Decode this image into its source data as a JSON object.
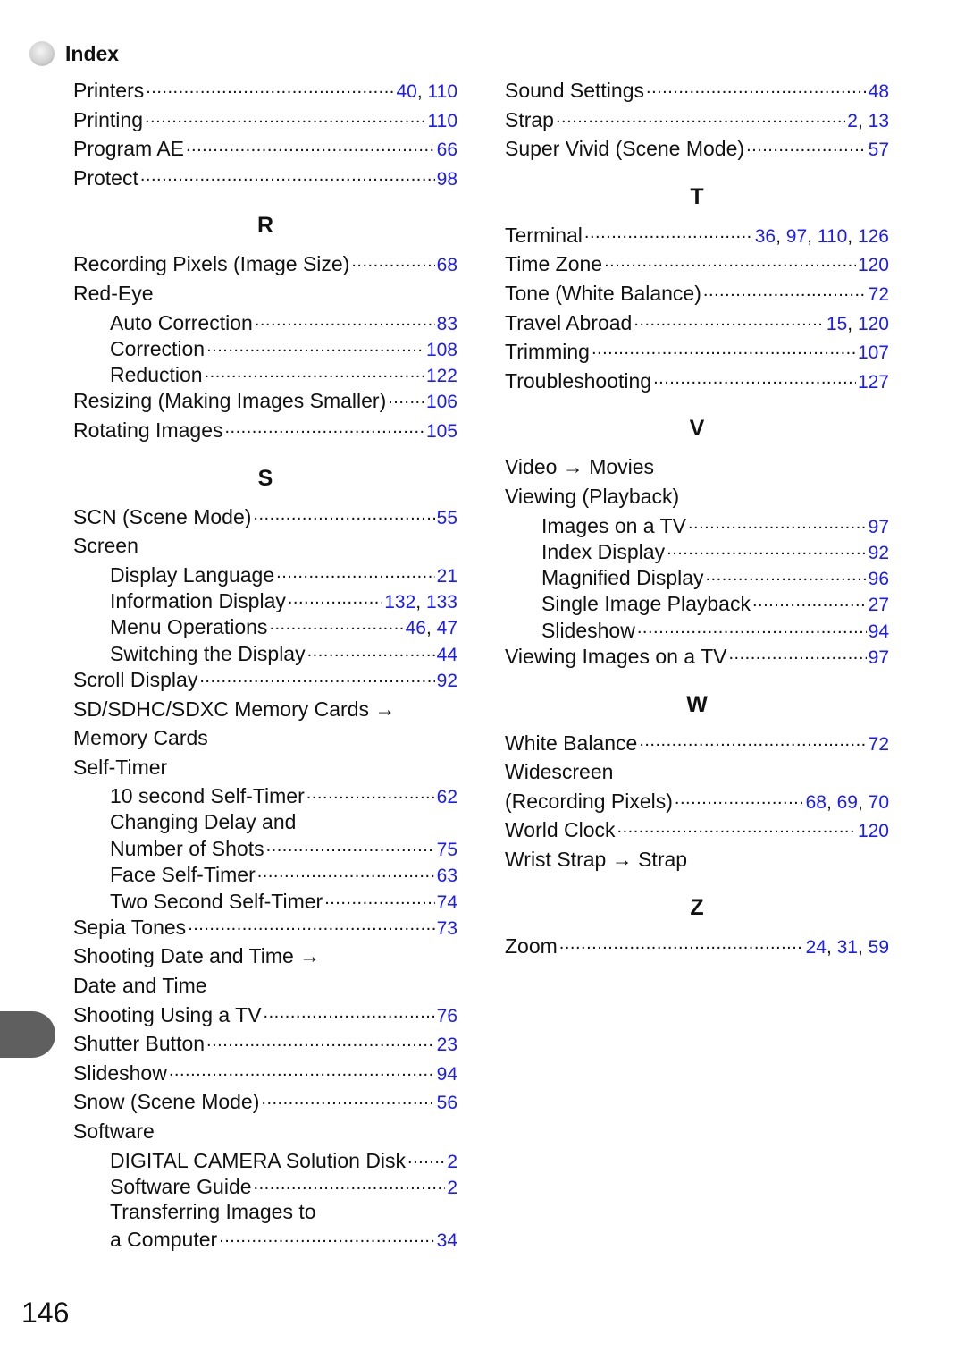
{
  "header": {
    "title": "Index",
    "icon": "gray-sphere-bullet"
  },
  "page_number": "146",
  "colors": {
    "page_ref": "#1a1aff",
    "text": "#111111",
    "side_tab": "#5f5f5f"
  },
  "left_column": [
    {
      "type": "entry",
      "term": "Printers",
      "pages": [
        "40",
        "110"
      ]
    },
    {
      "type": "entry",
      "term": "Printing",
      "pages": [
        "110"
      ]
    },
    {
      "type": "entry",
      "term": "Program AE",
      "pages": [
        "66"
      ]
    },
    {
      "type": "entry",
      "term": "Protect",
      "pages": [
        "98"
      ]
    },
    {
      "type": "letter",
      "term": "R"
    },
    {
      "type": "entry",
      "term": "Recording Pixels (Image Size)",
      "pages": [
        "68"
      ]
    },
    {
      "type": "entry",
      "term": "Red-Eye",
      "pages": []
    },
    {
      "type": "sub",
      "term": "Auto Correction",
      "pages": [
        "83"
      ]
    },
    {
      "type": "sub",
      "term": "Correction",
      "pages": [
        "108"
      ]
    },
    {
      "type": "sub",
      "term": "Reduction",
      "pages": [
        "122"
      ]
    },
    {
      "type": "entry",
      "term": "Resizing (Making Images Smaller)",
      "pages": [
        "106"
      ]
    },
    {
      "type": "entry",
      "term": "Rotating Images",
      "pages": [
        "105"
      ]
    },
    {
      "type": "letter",
      "term": "S"
    },
    {
      "type": "entry",
      "term": "SCN (Scene Mode)",
      "pages": [
        "55"
      ]
    },
    {
      "type": "entry",
      "term": "Screen",
      "pages": []
    },
    {
      "type": "sub",
      "term": "Display Language",
      "pages": [
        "21"
      ]
    },
    {
      "type": "sub",
      "term": "Information Display",
      "pages": [
        "132",
        "133"
      ]
    },
    {
      "type": "sub",
      "term": "Menu Operations",
      "pages": [
        "46",
        "47"
      ]
    },
    {
      "type": "sub",
      "term": "Switching the Display",
      "pages": [
        "44"
      ]
    },
    {
      "type": "entry",
      "term": "Scroll Display",
      "pages": [
        "92"
      ]
    },
    {
      "type": "entry",
      "term": "SD/SDHC/SDXC Memory Cards →",
      "pages": []
    },
    {
      "type": "entry",
      "term": "Memory Cards",
      "pages": []
    },
    {
      "type": "entry",
      "term": "Self-Timer",
      "pages": []
    },
    {
      "type": "sub",
      "term": "10 second Self-Timer",
      "pages": [
        "62"
      ]
    },
    {
      "type": "sub",
      "term": "Changing Delay and",
      "pages": []
    },
    {
      "type": "sub",
      "term": "Number of Shots",
      "pages": [
        "75"
      ]
    },
    {
      "type": "sub",
      "term": "Face Self-Timer",
      "pages": [
        "63"
      ]
    },
    {
      "type": "sub",
      "term": "Two Second Self-Timer",
      "pages": [
        "74"
      ]
    },
    {
      "type": "entry",
      "term": "Sepia Tones",
      "pages": [
        "73"
      ]
    },
    {
      "type": "entry",
      "term": "Shooting Date and Time →",
      "pages": []
    },
    {
      "type": "entry",
      "term": "Date and Time",
      "pages": []
    },
    {
      "type": "entry",
      "term": "Shooting Using a TV",
      "pages": [
        "76"
      ]
    },
    {
      "type": "entry",
      "term": "Shutter Button",
      "pages": [
        "23"
      ]
    },
    {
      "type": "entry",
      "term": "Slideshow",
      "pages": [
        "94"
      ]
    },
    {
      "type": "entry",
      "term": "Snow (Scene Mode)",
      "pages": [
        "56"
      ]
    },
    {
      "type": "entry",
      "term": "Software",
      "pages": []
    },
    {
      "type": "sub",
      "term": "DIGITAL CAMERA Solution Disk",
      "pages": [
        "2"
      ]
    },
    {
      "type": "sub",
      "term": "Software Guide",
      "pages": [
        "2"
      ]
    },
    {
      "type": "sub",
      "term": "Transferring Images to",
      "pages": []
    },
    {
      "type": "sub",
      "term": "a Computer",
      "pages": [
        "34"
      ]
    }
  ],
  "right_column": [
    {
      "type": "entry",
      "term": "Sound Settings",
      "pages": [
        "48"
      ]
    },
    {
      "type": "entry",
      "term": "Strap",
      "pages": [
        "2",
        "13"
      ]
    },
    {
      "type": "entry",
      "term": "Super Vivid (Scene Mode)",
      "pages": [
        "57"
      ]
    },
    {
      "type": "letter",
      "term": "T"
    },
    {
      "type": "entry",
      "term": "Terminal",
      "pages": [
        "36",
        "97",
        "110",
        "126"
      ]
    },
    {
      "type": "entry",
      "term": "Time Zone",
      "pages": [
        "120"
      ]
    },
    {
      "type": "entry",
      "term": "Tone (White Balance)",
      "pages": [
        "72"
      ]
    },
    {
      "type": "entry",
      "term": "Travel Abroad",
      "pages": [
        "15",
        "120"
      ]
    },
    {
      "type": "entry",
      "term": "Trimming",
      "pages": [
        "107"
      ]
    },
    {
      "type": "entry",
      "term": "Troubleshooting",
      "pages": [
        "127"
      ]
    },
    {
      "type": "letter",
      "term": "V"
    },
    {
      "type": "entry",
      "term": "Video → Movies",
      "pages": []
    },
    {
      "type": "entry",
      "term": "Viewing (Playback)",
      "pages": []
    },
    {
      "type": "sub",
      "term": "Images on a TV",
      "pages": [
        "97"
      ]
    },
    {
      "type": "sub",
      "term": "Index Display",
      "pages": [
        "92"
      ]
    },
    {
      "type": "sub",
      "term": "Magnified Display",
      "pages": [
        "96"
      ]
    },
    {
      "type": "sub",
      "term": "Single Image Playback",
      "pages": [
        "27"
      ]
    },
    {
      "type": "sub",
      "term": "Slideshow",
      "pages": [
        "94"
      ]
    },
    {
      "type": "entry",
      "term": "Viewing Images on a TV",
      "pages": [
        "97"
      ]
    },
    {
      "type": "letter",
      "term": "W"
    },
    {
      "type": "entry",
      "term": "White Balance",
      "pages": [
        "72"
      ]
    },
    {
      "type": "entry",
      "term": "Widescreen",
      "pages": []
    },
    {
      "type": "entry",
      "term": "(Recording Pixels)",
      "pages": [
        "68",
        "69",
        "70"
      ]
    },
    {
      "type": "entry",
      "term": "World Clock",
      "pages": [
        "120"
      ]
    },
    {
      "type": "entry",
      "term": "Wrist Strap → Strap",
      "pages": []
    },
    {
      "type": "letter",
      "term": "Z"
    },
    {
      "type": "entry",
      "term": "Zoom",
      "pages": [
        "24",
        "31",
        "59"
      ]
    }
  ]
}
